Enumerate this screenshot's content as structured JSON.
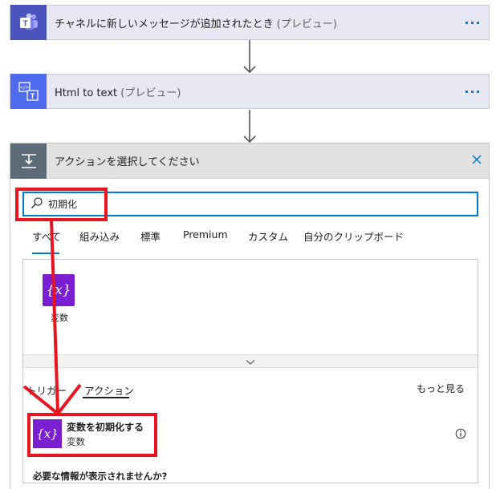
{
  "trigger_step": {
    "title": "チャネルに新しいメッセージが追加されたとき",
    "badge": "(プレビュー)",
    "more": "···"
  },
  "html_step": {
    "title": "Html to text",
    "badge": "(プレビュー)",
    "more": "···"
  },
  "action_panel": {
    "title": "アクションを選択してください",
    "close_icon": "close-icon",
    "search": {
      "value": "初期化",
      "icon": "search-icon"
    },
    "tabs": [
      "すべて",
      "組み込み",
      "標準",
      "Premium",
      "カスタム",
      "自分のクリップボード"
    ],
    "active_tab": "すべて",
    "connectors": [
      {
        "label": "変数",
        "icon_text": "{x}"
      }
    ],
    "sub_tabs": [
      "トリガー",
      "アクション"
    ],
    "active_sub_tab": "アクション",
    "see_more": "もっと見る",
    "operations": [
      {
        "title": "変数を初期化する",
        "subtitle": "変数",
        "icon_text": "{x}"
      }
    ],
    "help_text": "必要な情報が表示されませんか?"
  },
  "colors": {
    "accent": "#0078d4",
    "teams": "#5059c9",
    "variable": "#7a1fd1",
    "annotation": "#e8141f"
  }
}
